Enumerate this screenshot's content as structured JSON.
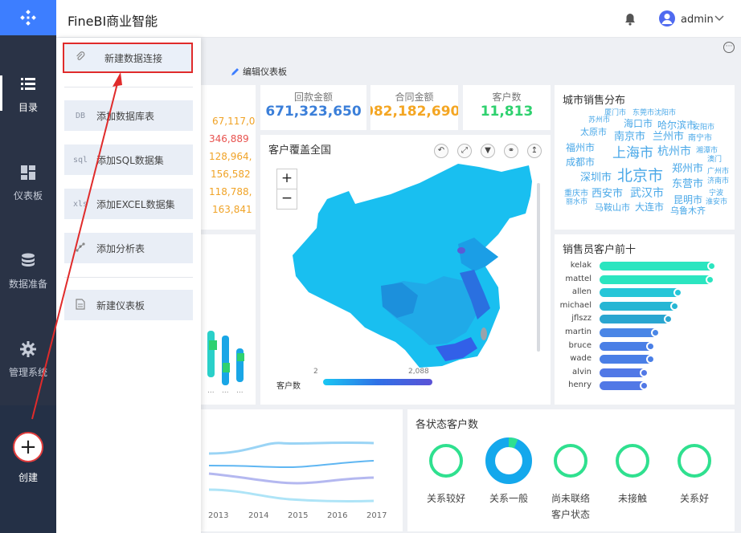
{
  "app": {
    "title": "FineBI商业智能",
    "username": "admin"
  },
  "nav": {
    "items": [
      {
        "label": "目录",
        "icon": "list-icon"
      },
      {
        "label": "仪表板",
        "icon": "dashboard-icon"
      },
      {
        "label": "数据准备",
        "icon": "database-icon"
      },
      {
        "label": "管理系统",
        "icon": "gear-icon"
      }
    ],
    "create": {
      "label": "创建",
      "symbol": "+"
    }
  },
  "flyout": {
    "new_connection": "新建数据连接",
    "items": [
      {
        "icon_text": "DB",
        "label": "添加数据库表"
      },
      {
        "icon_text": "sql",
        "label": "添加SQL数据集"
      },
      {
        "icon_text": "xls",
        "label": "添加EXCEL数据集"
      },
      {
        "icon_text": "",
        "label": "添加分析表"
      }
    ],
    "new_dashboard": "新建仪表板"
  },
  "toolbar": {
    "edit_dashboard": "编辑仪表板",
    "more": "···"
  },
  "kpis": [
    {
      "title": "回款金额",
      "value": "671,323,650",
      "color": "#3b7fd9"
    },
    {
      "title": "合同金额",
      "value": "082,182,690",
      "color": "#f4a623"
    },
    {
      "title": "客户数",
      "value": "11,813",
      "color": "#2fd16f"
    }
  ],
  "left_numbers": [
    "67,117,0",
    "346,889",
    "128,964,",
    "156,582",
    "118,788,",
    "163,841"
  ],
  "map": {
    "title": "客户覆盖全国",
    "zoom_in": "+",
    "zoom_out": "−",
    "legend_label": "客户数",
    "legend_min": "2",
    "legend_max": "2,088"
  },
  "word_cloud": {
    "title": "城市销售分布",
    "words": [
      "厦门市",
      "东莞市沈阳市",
      "苏州市",
      "海口市",
      "哈尔滨市",
      "安阳市",
      "太原市",
      "南京市",
      "兰州市",
      "南宁市",
      "福州市",
      "上海市",
      "杭州市",
      "湘潭市",
      "澳门",
      "成都市",
      "郑州市",
      "广州市",
      "济南市",
      "深圳市",
      "北京市",
      "东营市",
      "重庆市",
      "西安市",
      "武汉市",
      "宁波",
      "丽水市",
      "昆明市",
      "淮安市",
      "马鞍山市",
      "大连市",
      "乌鲁木齐"
    ]
  },
  "top_sales": {
    "title": "销售员客户前十",
    "names": [
      "kelak",
      "mattel",
      "allen",
      "michael",
      "jflszz",
      "martin",
      "bruce",
      "wade",
      "alvin",
      "henry"
    ]
  },
  "status": {
    "title": "各状态客户数",
    "labels": [
      "关系较好",
      "关系一般",
      "尚未联络",
      "未接触",
      "关系好"
    ],
    "axis_label": "客户状态"
  },
  "trend": {
    "years": [
      "2013",
      "2014",
      "2015",
      "2016",
      "2017"
    ]
  },
  "small_chart": {
    "tick_labels": [
      "...",
      "...",
      "..."
    ]
  }
}
